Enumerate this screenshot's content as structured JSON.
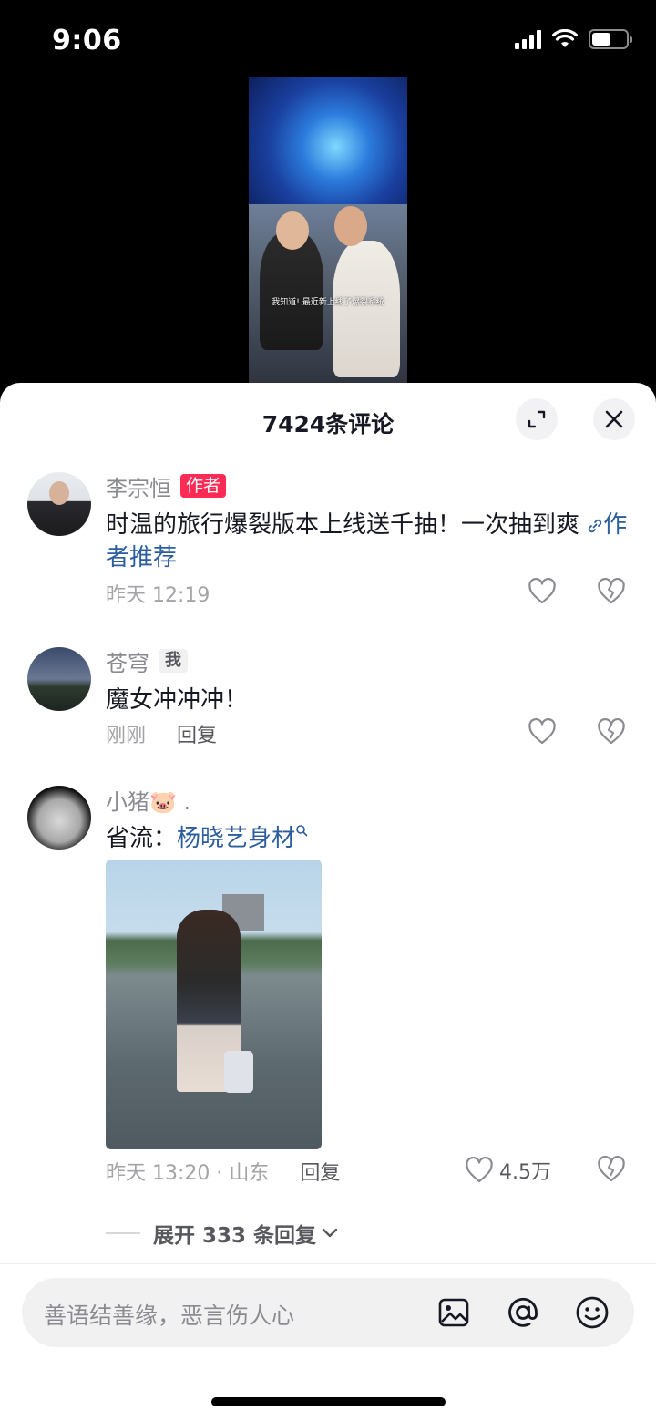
{
  "status_bar": {
    "time": "9:06",
    "battery_level": 0.55
  },
  "video": {
    "caption": "我知道! 最近新上线了爆裂系统"
  },
  "sheet": {
    "title": "7424条评论"
  },
  "comments": [
    {
      "name": "李宗恒",
      "tag": "作者",
      "text": "时温的旅行爆裂版本上线送千抽！一次抽到爽",
      "link": "作者推荐",
      "time": "昨天 12:19",
      "likes": ""
    },
    {
      "name": "苍穹",
      "tag": "我",
      "text": "魔女冲冲冲！",
      "time": "刚刚",
      "reply": "回复",
      "likes": ""
    },
    {
      "name": "小猪🐷 .",
      "text_prefix": "省流：",
      "search_link": "杨晓艺身材",
      "time": "昨天 13:20 · 山东",
      "reply": "回复",
      "likes": "4.5万",
      "expand": "展开 333 条回复"
    }
  ],
  "input": {
    "placeholder": "善语结善缘，恶言伤人心"
  },
  "icons": {
    "expand": "expand-icon",
    "close": "close-icon",
    "like": "heart-icon",
    "dislike": "broken-heart-icon",
    "image": "image-icon",
    "mention": "at-icon",
    "emoji": "emoji-icon"
  },
  "colors": {
    "author_tag": "#fe2c55",
    "link": "#2c5d9c"
  }
}
